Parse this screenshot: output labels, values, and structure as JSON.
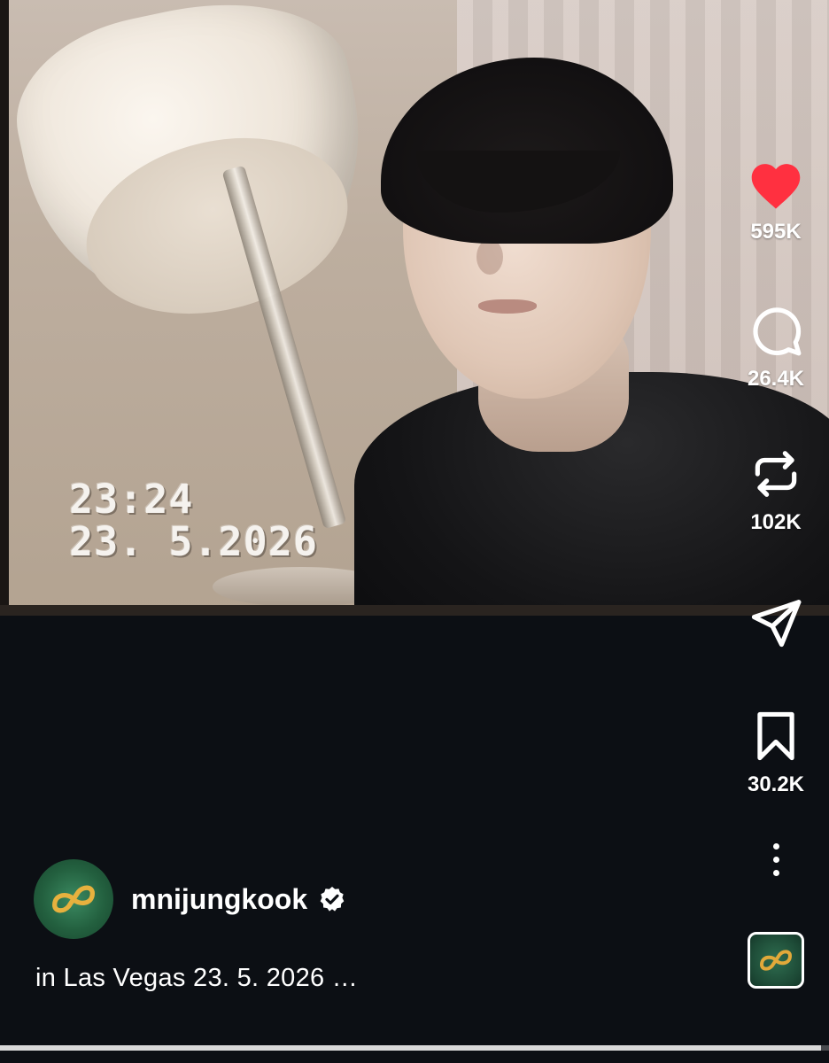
{
  "video": {
    "timestamp_time": "23:24",
    "timestamp_date": "23. 5.2026"
  },
  "actions": {
    "like": {
      "icon": "heart-icon",
      "count": "595K",
      "color": "#ff3040",
      "liked": true
    },
    "comment": {
      "icon": "comment-icon",
      "count": "26.4K"
    },
    "repost": {
      "icon": "repost-icon",
      "count": "102K"
    },
    "share": {
      "icon": "send-icon"
    },
    "save": {
      "icon": "bookmark-icon",
      "count": "30.2K"
    },
    "more": {
      "icon": "more-vertical-icon"
    },
    "audio": {
      "icon": "audio-thumbnail"
    }
  },
  "author": {
    "username": "mnijungkook",
    "verified": true
  },
  "caption": {
    "text": "in Las Vegas 23. 5. 2026 …"
  },
  "playback": {
    "progress": 0.99
  },
  "colors": {
    "background": "#0c0f14",
    "accent_like": "#ff3040",
    "avatar_green": "#23603f",
    "text": "#ffffff"
  }
}
